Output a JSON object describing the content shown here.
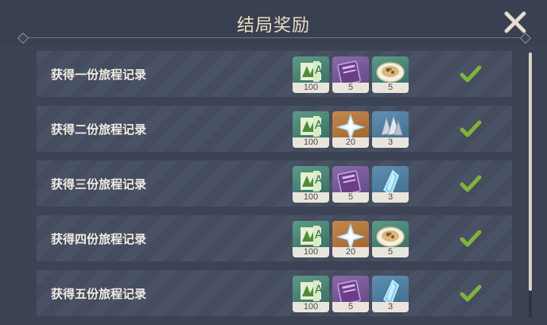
{
  "window": {
    "title": "结局奖励"
  },
  "icons": {
    "close": "close-x-icon",
    "check": "checkmark-icon"
  },
  "colors": {
    "title": "#e8dcc0",
    "check": "#7fb336",
    "row_bg": "#454d60",
    "count_bg": "#e9e5dc"
  },
  "rewards": [
    {
      "label": "获得一份旅程记录",
      "items": [
        {
          "icon": "adventure-exp-icon",
          "rarity": "green",
          "count": "100"
        },
        {
          "icon": "wanderers-advice-book-icon",
          "rarity": "purple",
          "count": "5"
        },
        {
          "icon": "food-dish-icon",
          "rarity": "green",
          "count": "5"
        }
      ],
      "completed": true
    },
    {
      "label": "获得二份旅程记录",
      "items": [
        {
          "icon": "adventure-exp-icon",
          "rarity": "green",
          "count": "100"
        },
        {
          "icon": "primogem-icon",
          "rarity": "orange",
          "count": "20"
        },
        {
          "icon": "mystic-enhancement-ore-icon",
          "rarity": "blue",
          "count": "3"
        }
      ],
      "completed": true
    },
    {
      "label": "获得三份旅程记录",
      "items": [
        {
          "icon": "adventure-exp-icon",
          "rarity": "green",
          "count": "100"
        },
        {
          "icon": "wanderers-advice-book-icon",
          "rarity": "purple",
          "count": "5"
        },
        {
          "icon": "crystal-chunk-icon",
          "rarity": "blue",
          "count": "3"
        }
      ],
      "completed": true
    },
    {
      "label": "获得四份旅程记录",
      "items": [
        {
          "icon": "adventure-exp-icon",
          "rarity": "green",
          "count": "100"
        },
        {
          "icon": "primogem-icon",
          "rarity": "orange",
          "count": "20"
        },
        {
          "icon": "food-dish-icon",
          "rarity": "green",
          "count": "5"
        }
      ],
      "completed": true
    },
    {
      "label": "获得五份旅程记录",
      "items": [
        {
          "icon": "adventure-exp-icon",
          "rarity": "green",
          "count": "100"
        },
        {
          "icon": "wanderers-advice-book-icon",
          "rarity": "purple",
          "count": "5"
        },
        {
          "icon": "crystal-chunk-icon",
          "rarity": "blue",
          "count": "3"
        }
      ],
      "completed": true
    }
  ]
}
